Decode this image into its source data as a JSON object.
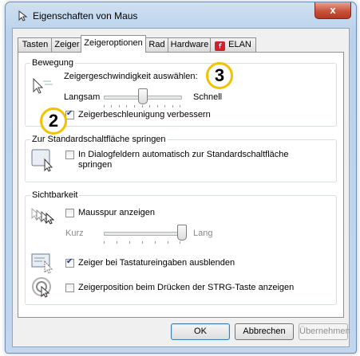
{
  "window": {
    "title": "Eigenschaften von Maus",
    "close_label": "x"
  },
  "tabs": [
    {
      "label": "Tasten"
    },
    {
      "label": "Zeiger"
    },
    {
      "label": "Zeigeroptionen"
    },
    {
      "label": "Rad"
    },
    {
      "label": "Hardware"
    },
    {
      "label": "ELAN",
      "logo": "elan-logo"
    }
  ],
  "bewegung": {
    "title": "Bewegung",
    "speed_label": "Zeigergeschwindigkeit auswählen:",
    "slow_label": "Langsam",
    "fast_label": "Schnell",
    "speed_fraction": 0.5,
    "acceleration_label": "Zeigerbeschleunigung verbessern",
    "acceleration_checked": true
  },
  "snap": {
    "title": "Zur Standardschaltfläche springen",
    "line1": "In Dialogfeldern automatisch zur Standardschaltfläche",
    "line2": "springen",
    "checked": false
  },
  "visibility": {
    "title": "Sichtbarkeit",
    "trail_label": "Mausspur anzeigen",
    "trail_checked": false,
    "short_label": "Kurz",
    "long_label": "Lang",
    "trail_fraction": 1.0,
    "hide_label": "Zeiger bei Tastatureingaben ausblenden",
    "hide_checked": true,
    "ctrl_label": "Zeigerposition beim Drücken der STRG-Taste anzeigen",
    "ctrl_checked": false
  },
  "buttons": {
    "ok": "OK",
    "cancel": "Abbrechen",
    "apply": "Übernehmen"
  },
  "annotations": {
    "badge_2": "2",
    "badge_3": "3"
  },
  "icons": {
    "title": "mouse-pointer-icon",
    "speed": "pointer-speed-icon",
    "snap": "snap-to-button-icon",
    "trail": "pointer-trail-icon",
    "hide": "hide-pointer-icon",
    "ctrl": "pointer-location-icon"
  },
  "colors": {
    "badge_border": "#f2c200",
    "close_button": "#c8523b",
    "elan_logo": "#d0202a"
  }
}
